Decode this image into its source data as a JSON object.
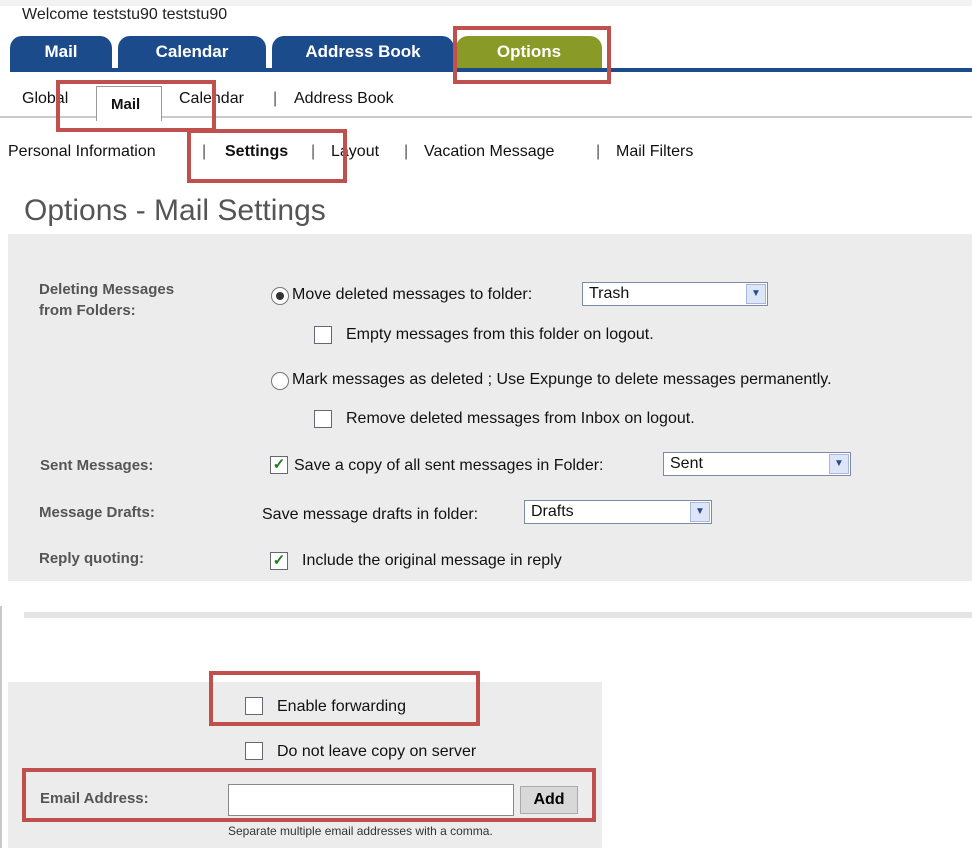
{
  "header": {
    "welcome": "Welcome teststu90 teststu90"
  },
  "main_tabs": [
    {
      "label": "Mail"
    },
    {
      "label": "Calendar"
    },
    {
      "label": "Address Book"
    },
    {
      "label": "Options",
      "active": true
    }
  ],
  "sub_tabs": {
    "global": "Global",
    "mail": "Mail",
    "calendar": "Calendar",
    "address_book": "Address Book"
  },
  "third_nav": {
    "personal": "Personal Information",
    "settings": "Settings",
    "layout": "Layout",
    "vacation": "Vacation Message",
    "filters": "Mail Filters",
    "separator": "|"
  },
  "page_title": "Options - Mail Settings",
  "settings": {
    "deleting_label_1": "Deleting Messages",
    "deleting_label_2": "from Folders:",
    "move_deleted": "Move deleted messages to folder:",
    "move_folder": "Trash",
    "empty_on_logout": "Empty messages from this folder on logout.",
    "mark_deleted": "Mark messages as deleted ; Use Expunge to delete messages permanently.",
    "remove_on_logout": "Remove deleted messages from Inbox on logout.",
    "sent_label": "Sent Messages:",
    "save_copy": "Save a copy of all sent messages in Folder:",
    "sent_folder": "Sent",
    "drafts_label": "Message Drafts:",
    "save_drafts": "Save message drafts in folder:",
    "drafts_folder": "Drafts",
    "reply_label": "Reply quoting:",
    "include_original": "Include the original message in reply"
  },
  "forwarding": {
    "enable": "Enable forwarding",
    "no_copy": "Do not leave copy on server",
    "email_label": "Email Address:",
    "email_value": "",
    "add_button": "Add",
    "hint": "Separate multiple email addresses with a comma."
  },
  "colors": {
    "tab_blue": "#1c4b8c",
    "tab_options": "#8a9a26",
    "highlight": "#c0504d",
    "panel": "#ececec"
  }
}
